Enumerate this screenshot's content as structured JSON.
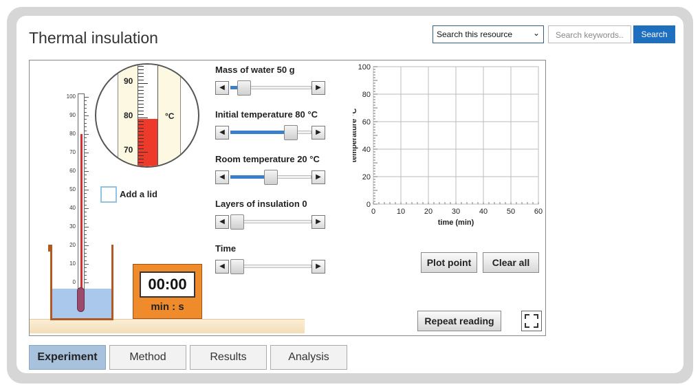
{
  "app": {
    "title": "Thermal insulation"
  },
  "header": {
    "scope_select": "Search this resource",
    "search_placeholder": "Search keywords..",
    "search_button": "Search"
  },
  "thermometer": {
    "scale_labels": [
      "100",
      "90",
      "80",
      "70",
      "60",
      "50",
      "40",
      "30",
      "20",
      "10",
      "0"
    ],
    "reading_c": 80
  },
  "zoom": {
    "labels": [
      "90",
      "80",
      "70"
    ],
    "unit": "°C"
  },
  "lid": {
    "label": "Add a lid",
    "checked": false
  },
  "timer": {
    "value": "00:00",
    "unit": "min : s"
  },
  "sliders": [
    {
      "label": "Mass of water 50 g",
      "fraction": 0.1
    },
    {
      "label": "Initial temperature 80 °C",
      "fraction": 0.8
    },
    {
      "label": "Room temperature 20 °C",
      "fraction": 0.5
    },
    {
      "label": "Layers of insulation 0",
      "fraction": 0.0
    },
    {
      "label": "Time",
      "fraction": 0.0
    }
  ],
  "chart_data": {
    "type": "scatter",
    "xlabel": "time (min)",
    "ylabel": "temperature °C",
    "xlim": [
      0,
      60
    ],
    "ylim": [
      0,
      100
    ],
    "x_ticks": [
      "0",
      "10",
      "20",
      "30",
      "40",
      "50",
      "60"
    ],
    "y_ticks": [
      "0",
      "20",
      "40",
      "60",
      "80",
      "100"
    ],
    "grid": true,
    "points": []
  },
  "buttons": {
    "plot_point": "Plot point",
    "clear_all": "Clear all",
    "repeat_reading": "Repeat reading"
  },
  "tabs": [
    {
      "label": "Experiment",
      "active": true
    },
    {
      "label": "Method",
      "active": false
    },
    {
      "label": "Results",
      "active": false
    },
    {
      "label": "Analysis",
      "active": false
    }
  ],
  "colors": {
    "accent": "#1f6fbf",
    "liquid": "#ee3a2a",
    "timer": "#ef8b2a",
    "active_tab": "#a8c2de"
  }
}
